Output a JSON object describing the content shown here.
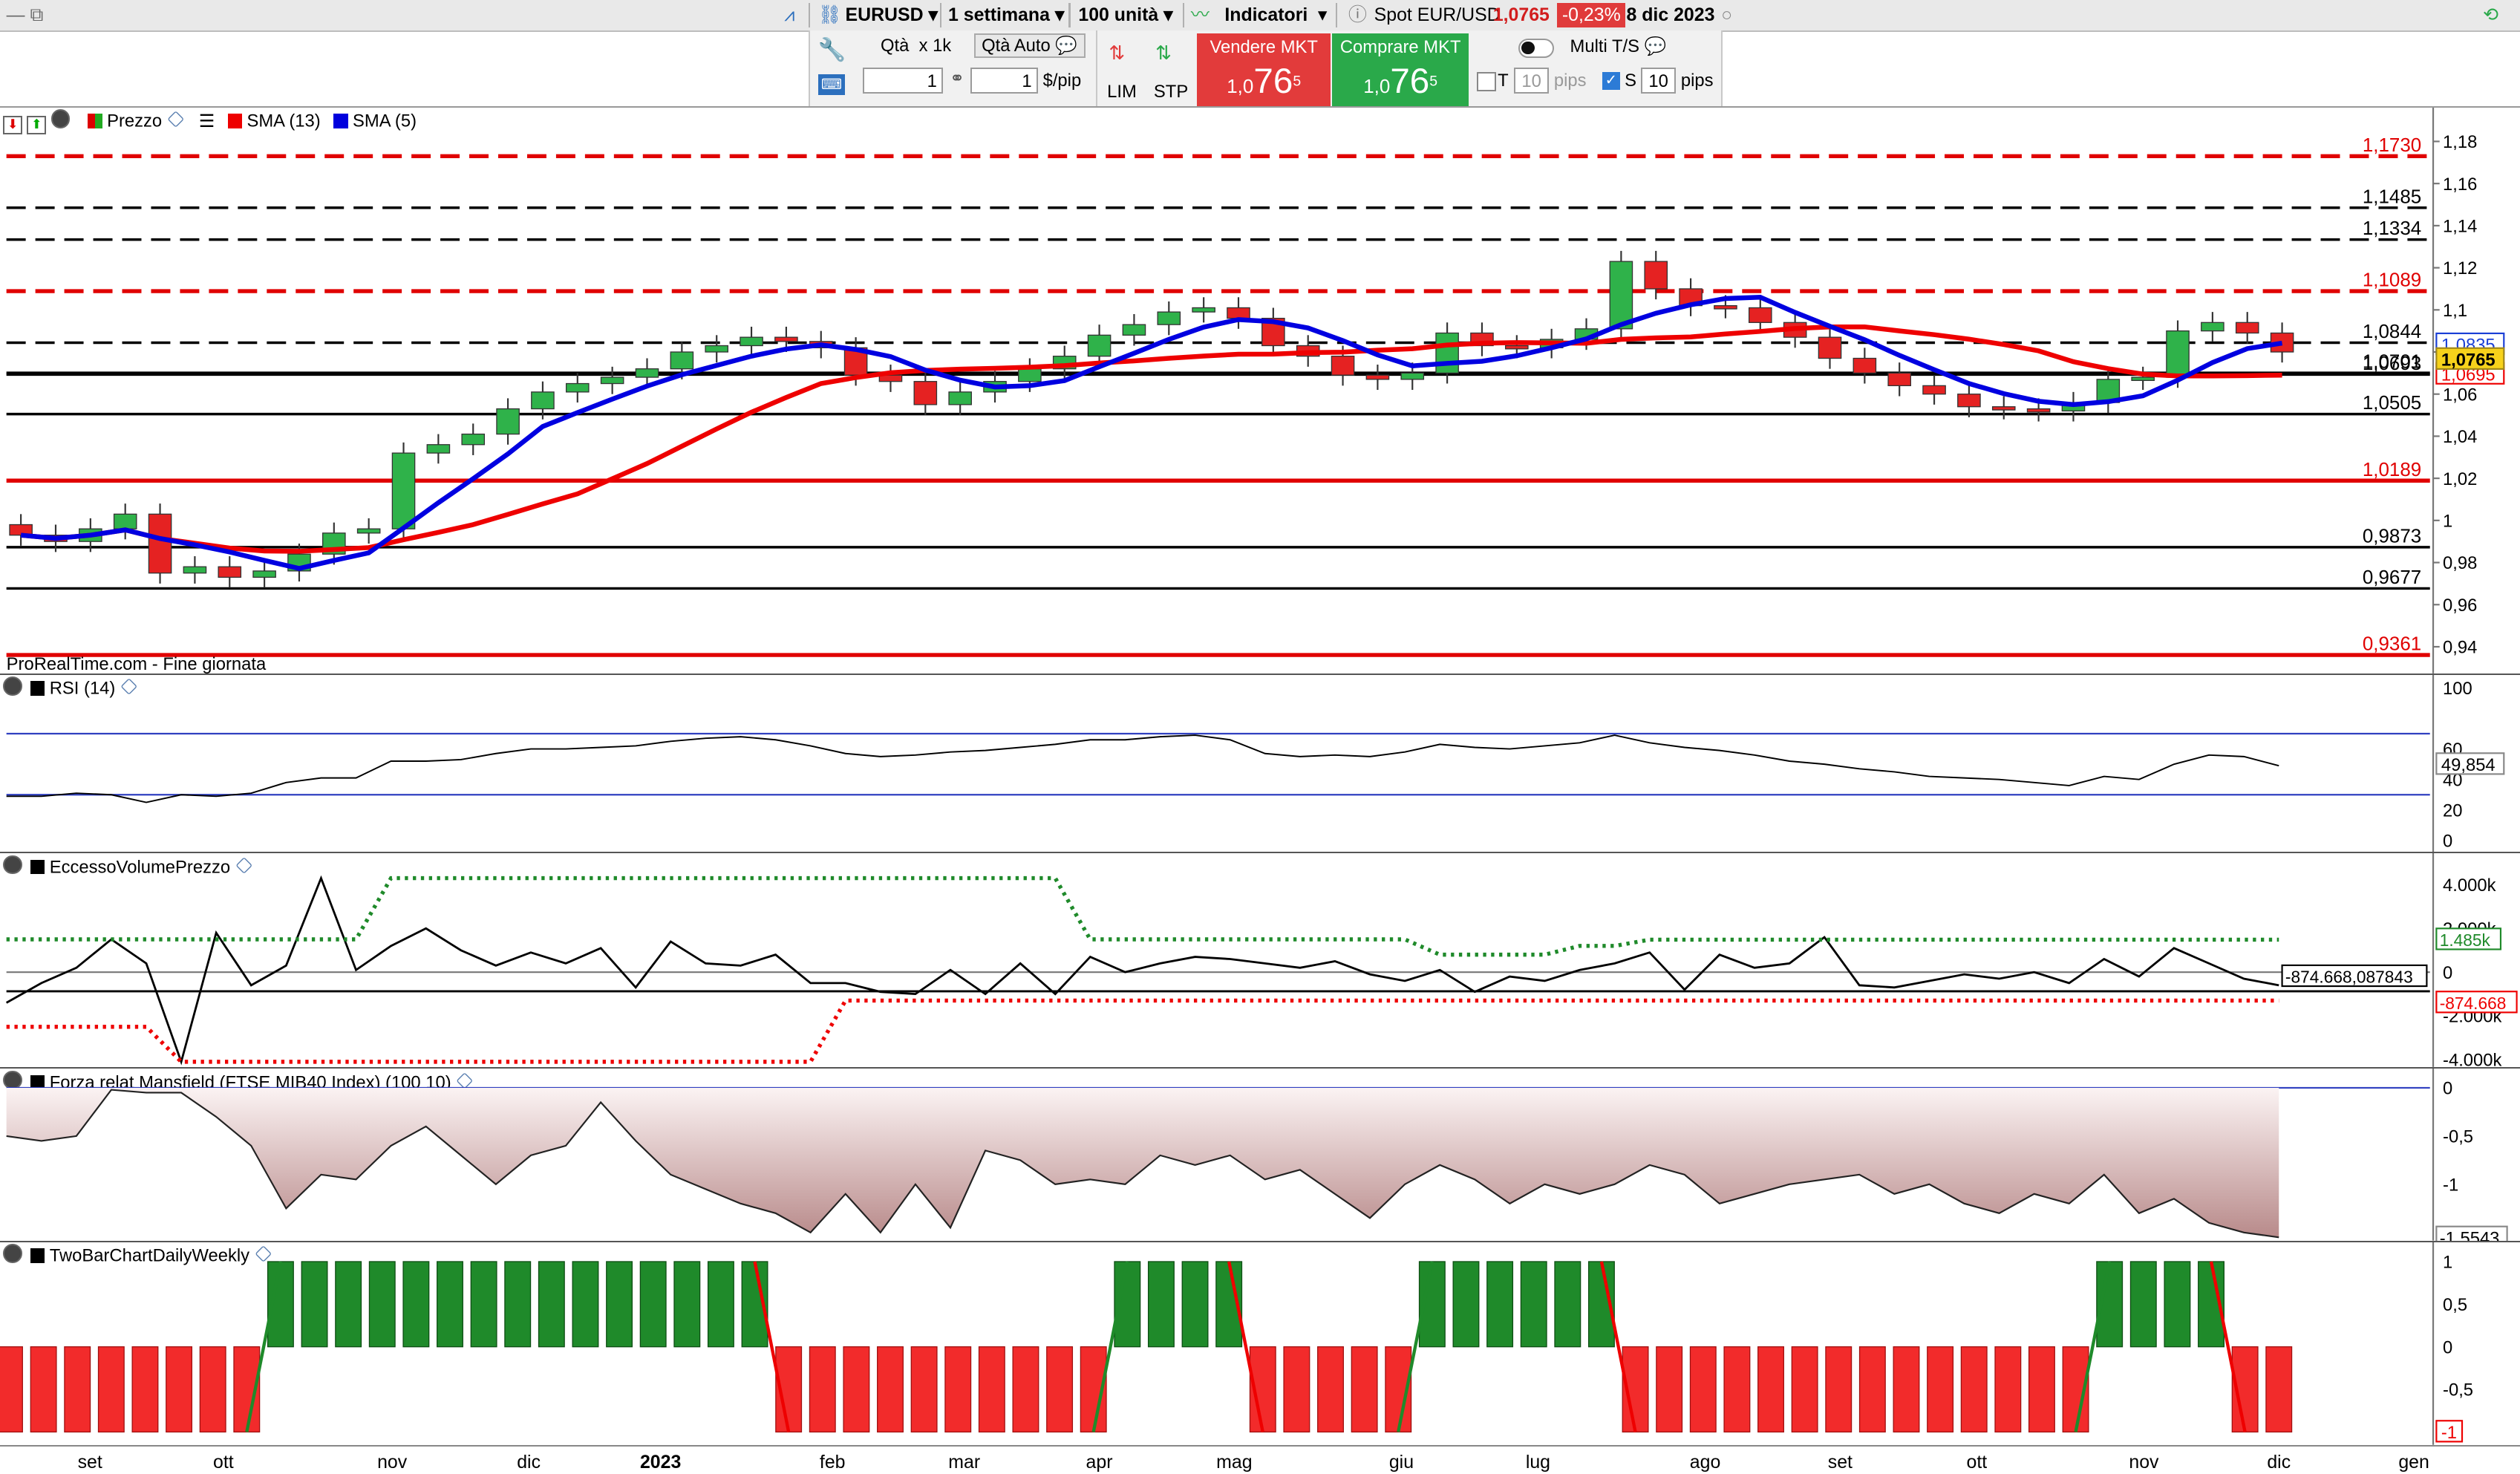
{
  "toolbar": {
    "symbol": "EURUSD",
    "timeframe": "1 settimana",
    "units": "100 unità",
    "indicators": "Indicatori",
    "spot_label": "Spot EUR/USD",
    "spot_price": "1,0765",
    "spot_change": "-0,23%",
    "date": "8 dic 2023",
    "colors": {
      "change_bg": "#e03b3b",
      "price": "#d21d1d"
    }
  },
  "order_bar": {
    "qty_label": "Qtà",
    "qty_mult": "x 1k",
    "qty_auto": "Qtà Auto",
    "qty_value": "1",
    "pip_value": "1",
    "pip_unit": "$/pip",
    "lim": "LIM",
    "stp": "STP",
    "sell_label": "Vendere MKT",
    "sell_prefix": "1,0",
    "sell_big": "76",
    "sell_sup": "5",
    "buy_label": "Comprare MKT",
    "buy_prefix": "1,0",
    "buy_big": "76",
    "buy_sup": "5",
    "multi": "Multi T/S",
    "t_label": "T",
    "t_value": "10",
    "t_unit": "pips",
    "s_label": "S",
    "s_value": "10",
    "s_unit": "pips"
  },
  "price_panel": {
    "legend_price": "Prezzo",
    "legend_sma13": "SMA (13)",
    "legend_sma5": "SMA (5)",
    "source": "ProRealTime.com - Fine giornata",
    "axis": [
      "1,18",
      "1,16",
      "1,14",
      "1,12",
      "1,1",
      "1,08",
      "1,06",
      "1,04",
      "1,02",
      "1",
      "0,98",
      "0,96",
      "0,94"
    ],
    "levels": [
      {
        "value": "1,1730",
        "color": "#e00000",
        "dashed": true
      },
      {
        "value": "1,1485",
        "color": "#000000",
        "dashed": true
      },
      {
        "value": "1,1334",
        "color": "#000000",
        "dashed": true
      },
      {
        "value": "1,1089",
        "color": "#e00000",
        "dashed": true
      },
      {
        "value": "1,0844",
        "color": "#000000",
        "dashed": true
      },
      {
        "value": "1,0693",
        "color": "#000000",
        "dashed": false
      },
      {
        "value": "1,0701",
        "color": "#000000",
        "dashed": false
      },
      {
        "value": "1,0505",
        "color": "#000000",
        "dashed": false
      },
      {
        "value": "1,0189",
        "color": "#e00000",
        "dashed": false
      },
      {
        "value": "0,9873",
        "color": "#000000",
        "dashed": false
      },
      {
        "value": "0,9677",
        "color": "#000000",
        "dashed": false
      },
      {
        "value": "0,9361",
        "color": "#e00000",
        "dashed": false
      }
    ],
    "tag_sma5": "1,0835",
    "tag_price": "1,0765",
    "tag_sma13": "1,0695"
  },
  "rsi_panel": {
    "title": "RSI (14)",
    "axis": [
      "100",
      "60",
      "40",
      "20",
      "0"
    ],
    "tag": "49,854"
  },
  "evp_panel": {
    "title": "EccessoVolumePrezzo",
    "axis": [
      "4.000k",
      "2.000k",
      "0",
      "-2.000k",
      "-4.000k"
    ],
    "tag_top": "1.485k",
    "tag_mid": "-874.668,087843",
    "tag_low": "-874.668"
  },
  "mansfield_panel": {
    "title": "Forza relat Mansfield (FTSE MIB40 Index) (100 10)",
    "axis": [
      "0",
      "-0,5",
      "-1"
    ],
    "tag": "-1,5543"
  },
  "twobar_panel": {
    "title": "TwoBarChartDailyWeekly",
    "axis": [
      "1",
      "0,5",
      "0",
      "-0,5"
    ],
    "tag": "-1"
  },
  "months": [
    "set",
    "ott",
    "nov",
    "dic",
    "2023",
    "feb",
    "mar",
    "apr",
    "mag",
    "giu",
    "lug",
    "ago",
    "set",
    "ott",
    "nov",
    "dic",
    "gen"
  ],
  "chart_data": {
    "type": "candlestick",
    "title": "EURUSD",
    "ylim": [
      0.93,
      1.185
    ],
    "candles_close": [
      0.993,
      0.99,
      0.996,
      1.003,
      0.975,
      0.978,
      0.973,
      0.976,
      0.984,
      0.994,
      0.996,
      1.032,
      1.036,
      1.041,
      1.053,
      1.061,
      1.065,
      1.068,
      1.072,
      1.08,
      1.083,
      1.087,
      1.085,
      1.082,
      1.069,
      1.066,
      1.055,
      1.061,
      1.066,
      1.072,
      1.078,
      1.088,
      1.093,
      1.099,
      1.101,
      1.096,
      1.083,
      1.078,
      1.069,
      1.067,
      1.07,
      1.089,
      1.083,
      1.082,
      1.086,
      1.091,
      1.123,
      1.11,
      1.102,
      1.101,
      1.094,
      1.087,
      1.077,
      1.07,
      1.064,
      1.06,
      1.054,
      1.053,
      1.052,
      1.056,
      1.067,
      1.068,
      1.09,
      1.094,
      1.089,
      1.08
    ],
    "sma13_label": "SMA (13)",
    "sma5_label": "SMA (5)"
  }
}
